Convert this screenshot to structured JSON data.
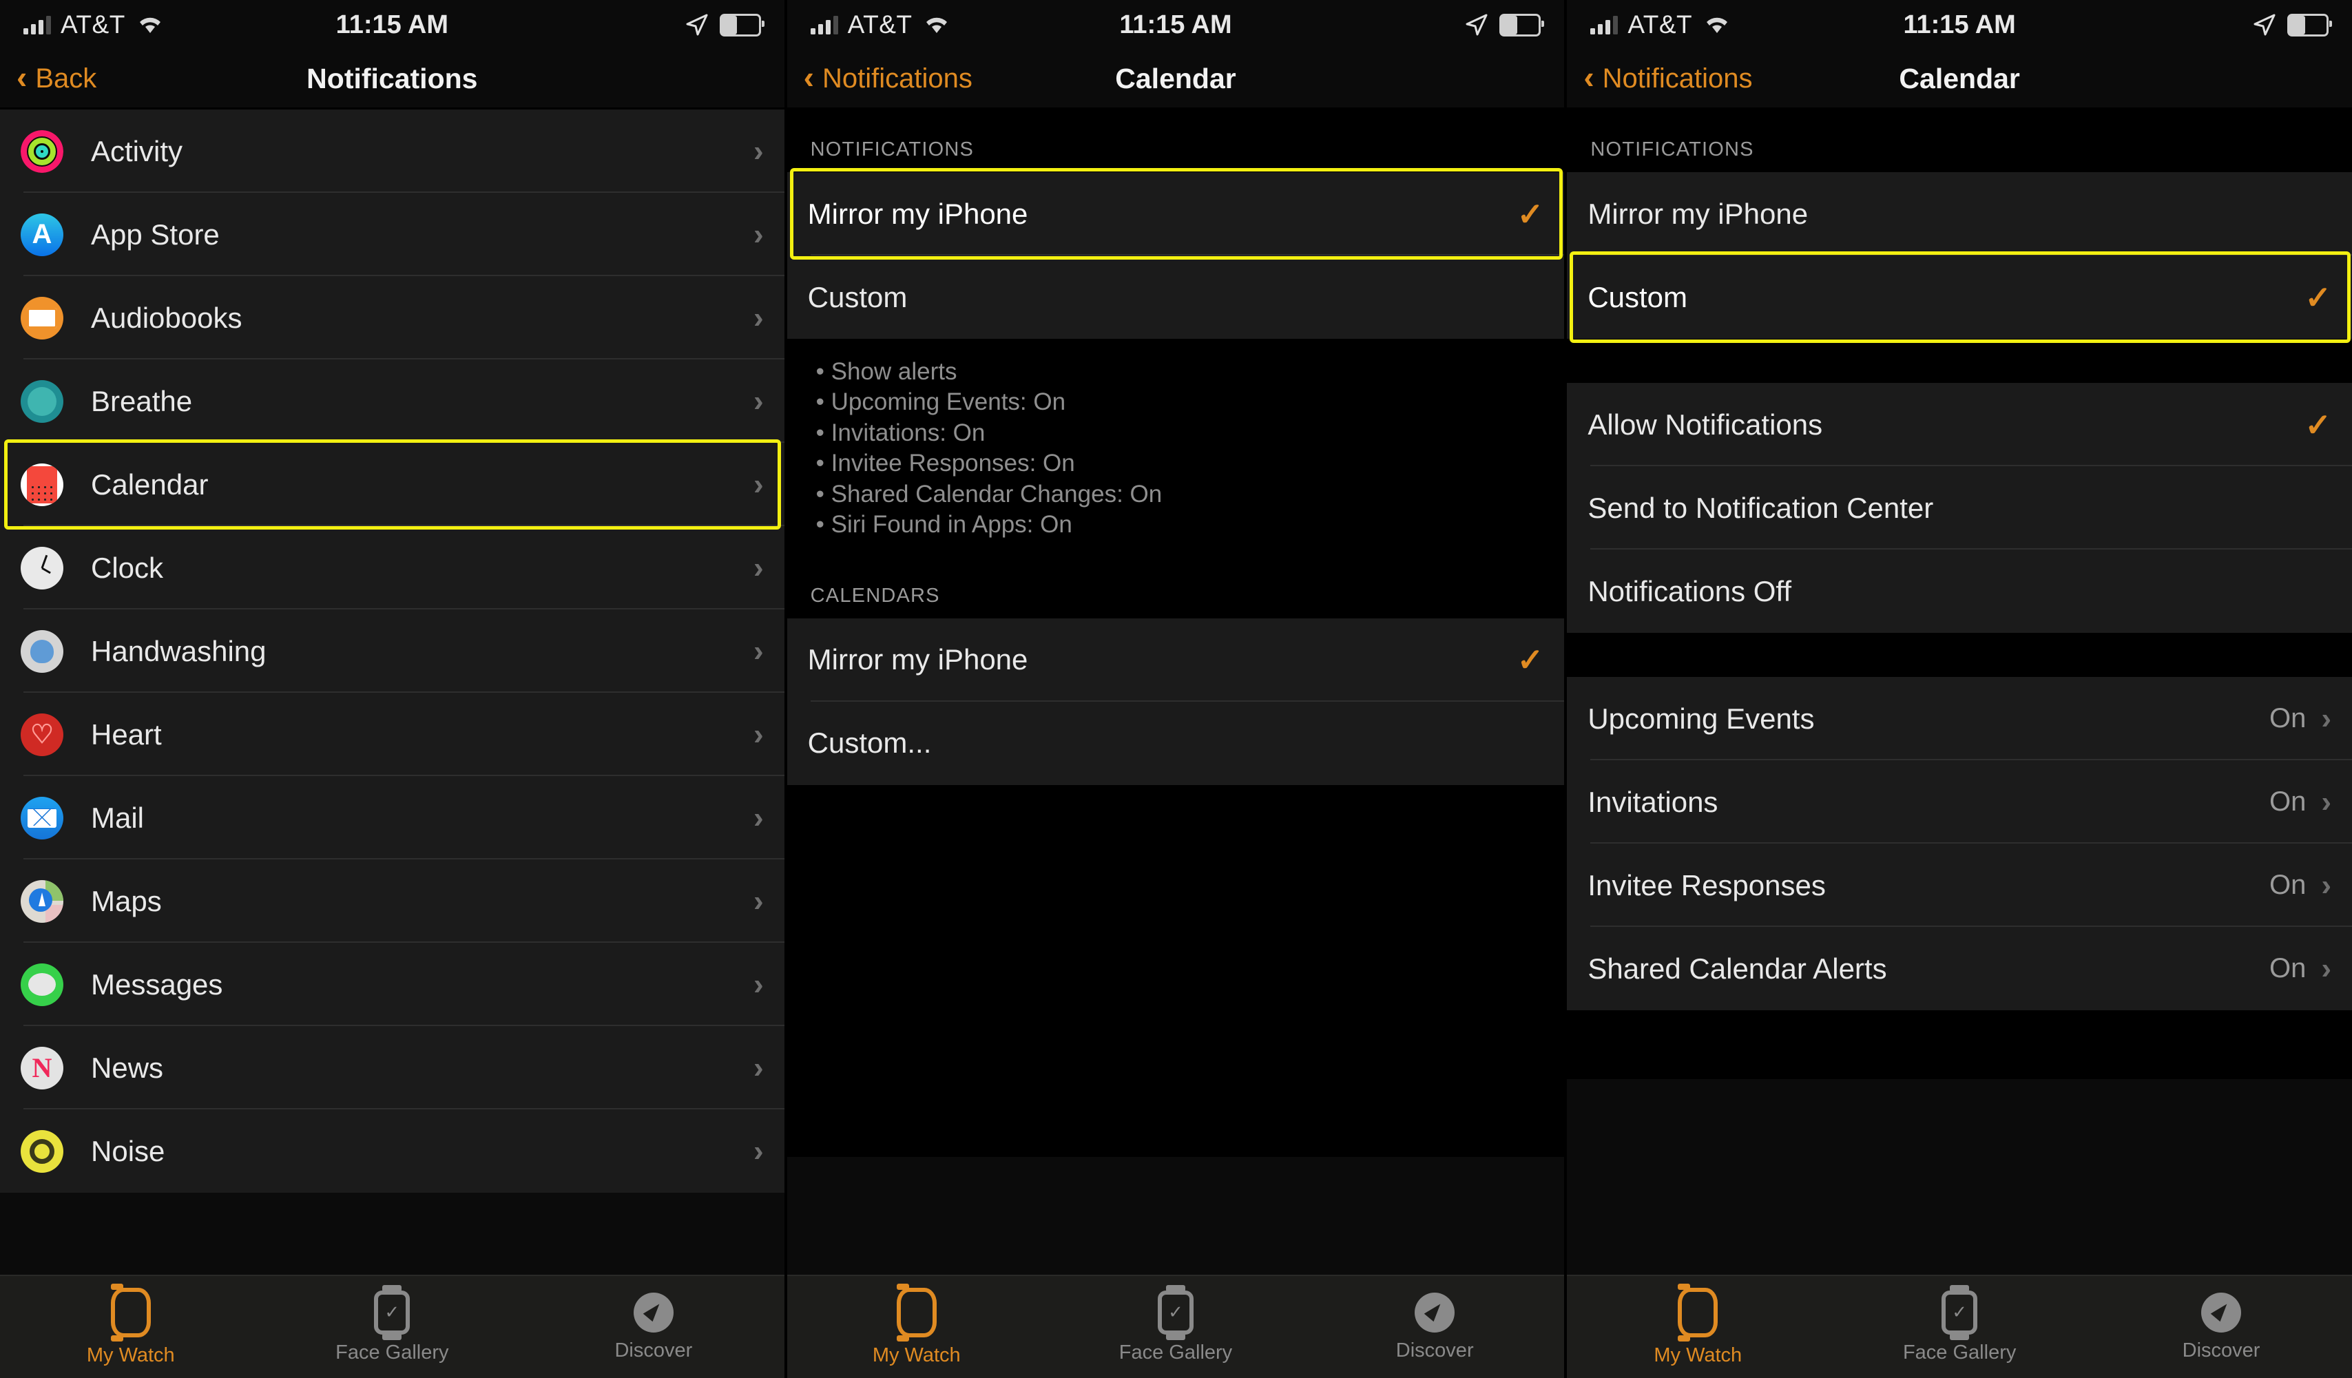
{
  "status_bar": {
    "carrier": "AT&T",
    "time": "11:15 AM",
    "signal_icon": "cellular-bars-icon",
    "wifi_icon": "wifi-icon",
    "location_icon": "location-arrow-icon",
    "battery_icon": "battery-icon"
  },
  "tab_bar": {
    "tabs": [
      {
        "label": "My Watch",
        "icon": "apple-watch-icon",
        "active": true
      },
      {
        "label": "Face Gallery",
        "icon": "watch-face-icon",
        "active": false
      },
      {
        "label": "Discover",
        "icon": "compass-icon",
        "active": false
      }
    ]
  },
  "panel1": {
    "nav": {
      "back_label": "Back",
      "title": "Notifications",
      "back_icon": "chevron-left-icon"
    },
    "apps": [
      {
        "label": "Activity",
        "icon": "activity-rings-icon",
        "highlighted": false
      },
      {
        "label": "App Store",
        "icon": "app-store-icon",
        "highlighted": false
      },
      {
        "label": "Audiobooks",
        "icon": "audiobooks-icon",
        "highlighted": false
      },
      {
        "label": "Breathe",
        "icon": "breathe-icon",
        "highlighted": false
      },
      {
        "label": "Calendar",
        "icon": "calendar-icon",
        "highlighted": true
      },
      {
        "label": "Clock",
        "icon": "clock-icon",
        "highlighted": false
      },
      {
        "label": "Handwashing",
        "icon": "handwashing-icon",
        "highlighted": false
      },
      {
        "label": "Heart",
        "icon": "heart-icon",
        "highlighted": false
      },
      {
        "label": "Mail",
        "icon": "mail-icon",
        "highlighted": false
      },
      {
        "label": "Maps",
        "icon": "maps-icon",
        "highlighted": false
      },
      {
        "label": "Messages",
        "icon": "messages-icon",
        "highlighted": false
      },
      {
        "label": "News",
        "icon": "news-icon",
        "highlighted": false
      },
      {
        "label": "Noise",
        "icon": "noise-icon",
        "highlighted": false
      }
    ]
  },
  "panel2": {
    "nav": {
      "back_label": "Notifications",
      "title": "Calendar",
      "back_icon": "chevron-left-icon"
    },
    "notifications_header": "NOTIFICATIONS",
    "notification_options": [
      {
        "label": "Mirror my iPhone",
        "checked": true,
        "highlighted": true
      },
      {
        "label": "Custom",
        "checked": false,
        "highlighted": false
      }
    ],
    "bullets": [
      "• Show alerts",
      "• Upcoming Events: On",
      "• Invitations: On",
      "• Invitee Responses: On",
      "• Shared Calendar Changes: On",
      "• Siri Found in Apps: On"
    ],
    "calendars_header": "CALENDARS",
    "calendar_options": [
      {
        "label": "Mirror my iPhone",
        "checked": true
      },
      {
        "label": "Custom...",
        "checked": false
      }
    ]
  },
  "panel3": {
    "nav": {
      "back_label": "Notifications",
      "title": "Calendar",
      "back_icon": "chevron-left-icon"
    },
    "notifications_header": "NOTIFICATIONS",
    "notification_options": [
      {
        "label": "Mirror my iPhone",
        "checked": false,
        "highlighted": false
      },
      {
        "label": "Custom",
        "checked": true,
        "highlighted": true
      }
    ],
    "alert_options": [
      {
        "label": "Allow Notifications",
        "checked": true
      },
      {
        "label": "Send to Notification Center",
        "checked": false
      },
      {
        "label": "Notifications Off",
        "checked": false
      }
    ],
    "detail_rows": [
      {
        "label": "Upcoming Events",
        "value": "On"
      },
      {
        "label": "Invitations",
        "value": "On"
      },
      {
        "label": "Invitee Responses",
        "value": "On"
      },
      {
        "label": "Shared Calendar Alerts",
        "value": "On"
      }
    ]
  },
  "colors": {
    "accent": "#e08b22",
    "highlight": "#f3f011",
    "list_bg": "#1b1b1b",
    "page_bg": "#000000"
  }
}
